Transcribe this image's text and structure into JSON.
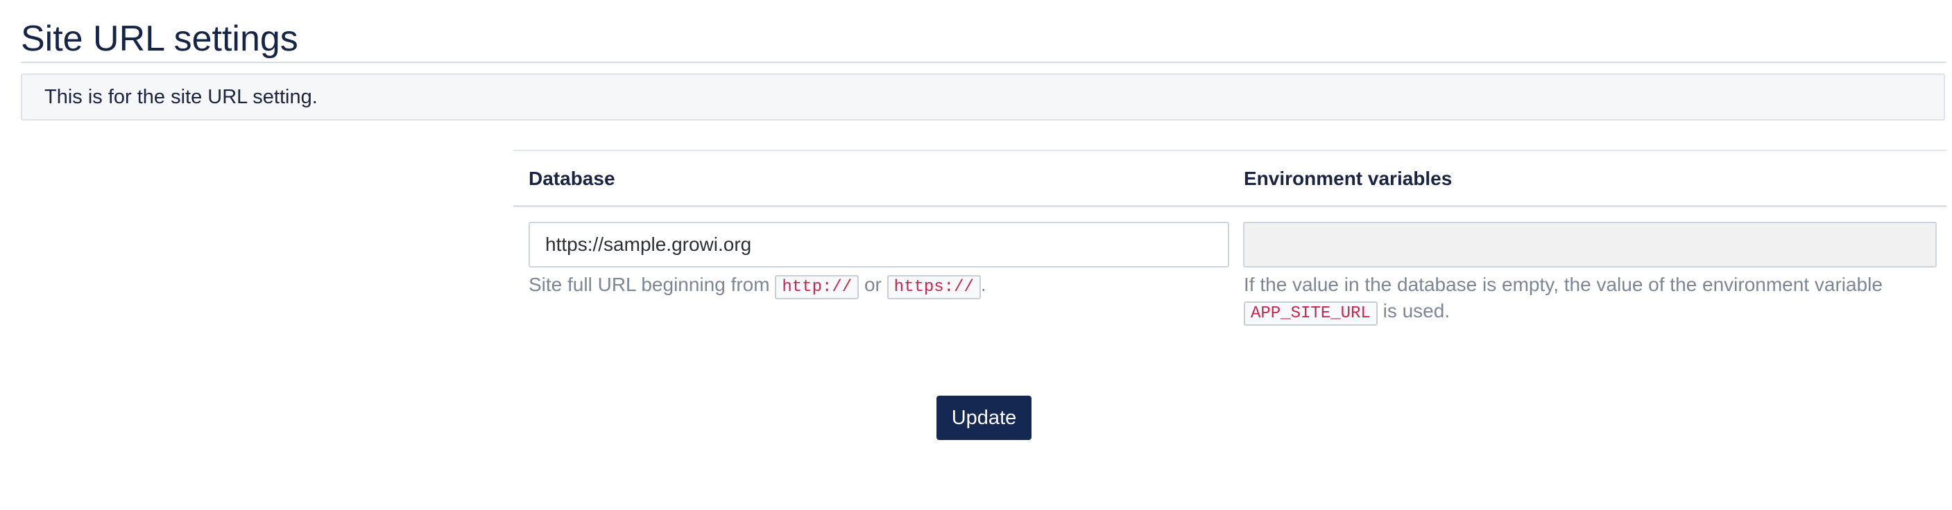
{
  "page": {
    "title": "Site URL settings",
    "info_text": "This is for the site URL setting."
  },
  "table": {
    "headers": {
      "database": "Database",
      "environment": "Environment variables"
    },
    "database": {
      "value": "https://sample.growi.org",
      "placeholder": "",
      "help_prefix": "Site full URL beginning from",
      "help_code_1": "http://",
      "help_or": "or",
      "help_code_2": "https://",
      "help_suffix": "."
    },
    "environment": {
      "value": "",
      "help_prefix": "If the value in the database is empty, the value of the environment variable",
      "help_code": "APP_SITE_URL",
      "help_suffix": "is used."
    }
  },
  "actions": {
    "update_label": "Update"
  },
  "colors": {
    "primary": "#142851",
    "code_text": "#c7254e",
    "help_text": "#7c8694"
  }
}
